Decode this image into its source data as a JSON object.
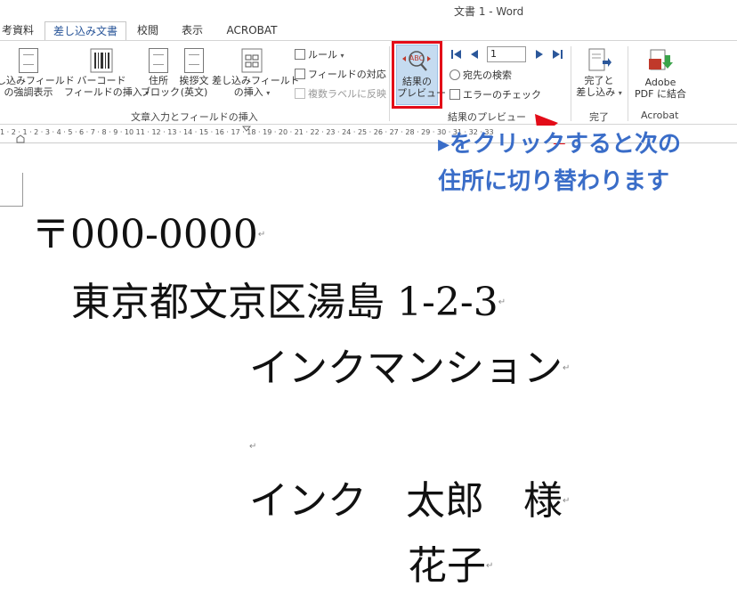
{
  "window": {
    "title": "文書 1 - Word"
  },
  "tabs": [
    {
      "label": "考資料",
      "active": false
    },
    {
      "label": "差し込み文書",
      "active": true
    },
    {
      "label": "校閲",
      "active": false
    },
    {
      "label": "表示",
      "active": false
    },
    {
      "label": "ACROBAT",
      "active": false
    }
  ],
  "ribbon": {
    "highlight_fields": {
      "line1": "し込みフィールド",
      "line2": "の強調表示"
    },
    "barcode": {
      "line1": "バーコード",
      "line2": "フィールドの挿入"
    },
    "address_block": {
      "line1": "住所",
      "line2": "ブロック"
    },
    "greeting": {
      "line1": "挨拶文",
      "line2": "(英文)"
    },
    "insert_field": {
      "line1": "差し込みフィールド",
      "line2": "の挿入"
    },
    "rules": "ルール",
    "match_fields": "フィールドの対応",
    "update_labels": "複数ラベルに反映",
    "group_write_insert": "文章入力とフィールドの挿入",
    "preview_results": {
      "line1": "結果の",
      "line2": "プレビュー",
      "icon_text": "ABC"
    },
    "record_number": "1",
    "find_recipient": "宛先の検索",
    "check_errors": "エラーのチェック",
    "group_preview": "結果のプレビュー",
    "finish_merge": {
      "line1": "完了と",
      "line2": "差し込み"
    },
    "group_finish": "完了",
    "adobe_pdf": {
      "line1": "Adobe",
      "line2": "PDF に結合"
    },
    "group_acrobat": "Acrobat"
  },
  "ruler": {
    "numbers": "1 · 2 · 1 · 2 · 3 · 4 · 5 · 6 · 7 · 8 · 9 · 10 11 · 12 · 13 · 14 · 15 · 16 · 17 · 18 · 19 · 20 · 21 · 22 · 23 · 24 · 25 · 26 · 27 · 28 · 29 · 30 · 31 · 32 · 33"
  },
  "document": {
    "postal": "〒000-0000",
    "address": "東京都文京区湯島 1-2-3",
    "building": "インクマンション",
    "name": "インク　太郎　様",
    "name2": "花子"
  },
  "annotation": {
    "line1": "▸をクリックすると次の",
    "line2": "住所に切り替わります"
  },
  "colors": {
    "accent": "#2b579a",
    "annotation": "#3a6dc8",
    "highlight": "#e30c18",
    "preview_bg": "#c5dbf0"
  }
}
